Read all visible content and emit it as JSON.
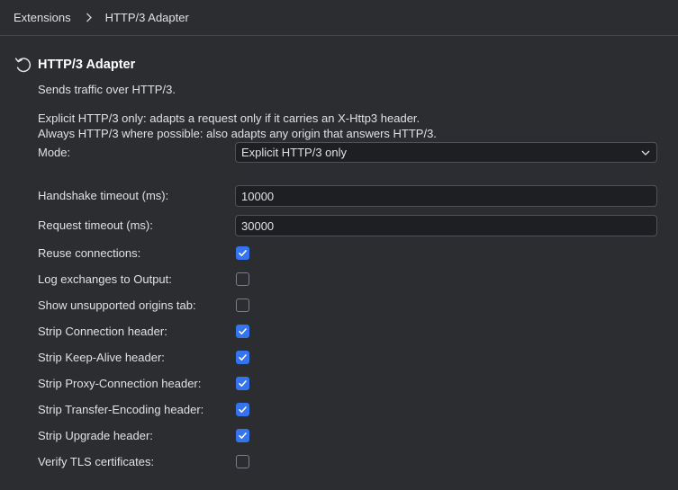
{
  "breadcrumb": {
    "root": "Extensions",
    "current": "HTTP/3 Adapter"
  },
  "plugin": {
    "title": "HTTP/3 Adapter",
    "description": "Sends traffic over HTTP/3.",
    "mode_help_1": "Explicit HTTP/3 only: adapts a request only if it carries an X-Http3 header.",
    "mode_help_2": "Always HTTP/3 where possible: also adapts any origin that answers HTTP/3."
  },
  "settings": {
    "mode": {
      "label": "Mode:",
      "value": "Explicit HTTP/3 only"
    },
    "handshake_timeout": {
      "label": "Handshake timeout (ms):",
      "value": "10000"
    },
    "request_timeout": {
      "label": "Request timeout (ms):",
      "value": "30000"
    },
    "checkboxes": [
      {
        "key": "reuse-connections",
        "label": "Reuse connections:",
        "checked": true
      },
      {
        "key": "log-exchanges",
        "label": "Log exchanges to Output:",
        "checked": false
      },
      {
        "key": "show-unsupported-origins-tab",
        "label": "Show unsupported origins tab:",
        "checked": false
      },
      {
        "key": "strip-connection-header",
        "label": "Strip Connection header:",
        "checked": true
      },
      {
        "key": "strip-keep-alive-header",
        "label": "Strip Keep-Alive header:",
        "checked": true
      },
      {
        "key": "strip-proxy-connection-header",
        "label": "Strip Proxy-Connection header:",
        "checked": true
      },
      {
        "key": "strip-transfer-encoding-header",
        "label": "Strip Transfer-Encoding header:",
        "checked": true
      },
      {
        "key": "strip-upgrade-header",
        "label": "Strip Upgrade header:",
        "checked": true
      },
      {
        "key": "verify-tls-certificates",
        "label": "Verify TLS certificates:",
        "checked": false
      }
    ]
  },
  "icons": {
    "breadcrumb_separator": "chevron-right-icon",
    "reset": "reset-icon",
    "dropdown": "chevron-down-icon",
    "checkmark": "checkmark-icon"
  },
  "colors": {
    "background": "#2b2d30",
    "field_background": "#1e1f22",
    "accent": "#3574f0"
  }
}
